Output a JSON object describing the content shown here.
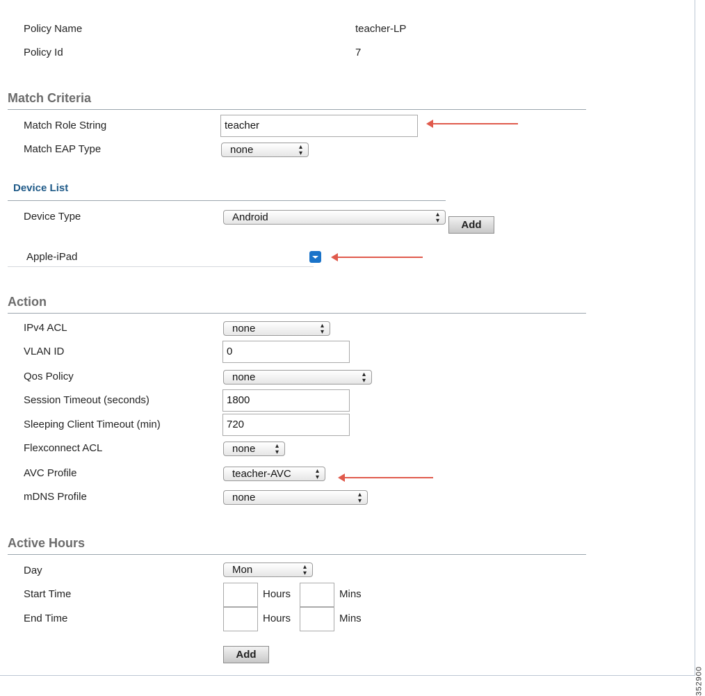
{
  "policy": {
    "name_label": "Policy Name",
    "name_value": "teacher-LP",
    "id_label": "Policy Id",
    "id_value": "7"
  },
  "match_criteria": {
    "title": "Match Criteria",
    "role_label": "Match Role String",
    "role_value": "teacher",
    "eap_label": "Match EAP Type",
    "eap_value": "none"
  },
  "device_list": {
    "title": "Device List",
    "type_label": "Device Type",
    "type_value": "Android",
    "add_label": "Add",
    "items": [
      {
        "label": "Apple-iPad"
      }
    ]
  },
  "action": {
    "title": "Action",
    "ipv4_label": "IPv4 ACL",
    "ipv4_value": "none",
    "vlan_label": "VLAN ID",
    "vlan_value": "0",
    "qos_label": "Qos Policy",
    "qos_value": "none",
    "session_label": "Session Timeout (seconds)",
    "session_value": "1800",
    "sleeping_label": "Sleeping Client Timeout (min)",
    "sleeping_value": "720",
    "flex_label": "Flexconnect ACL",
    "flex_value": "none",
    "avc_label": "AVC Profile",
    "avc_value": "teacher-AVC",
    "mdns_label": "mDNS Profile",
    "mdns_value": "none"
  },
  "active_hours": {
    "title": "Active Hours",
    "day_label": "Day",
    "day_value": "Mon",
    "start_label": "Start Time",
    "end_label": "End Time",
    "hours_label": "Hours",
    "mins_label": "Mins",
    "add_label": "Add"
  },
  "figure_id": "352900",
  "colors": {
    "annotation_arrow": "#e05a4c",
    "section_title": "#6b6b6b",
    "sub_title": "#1f5a88",
    "dropdown_icon": "#1a73c9"
  },
  "icons": {
    "select_arrows": "updown-arrows-icon",
    "dropdown": "chevron-down-icon",
    "annotation": "arrow-left-icon"
  }
}
